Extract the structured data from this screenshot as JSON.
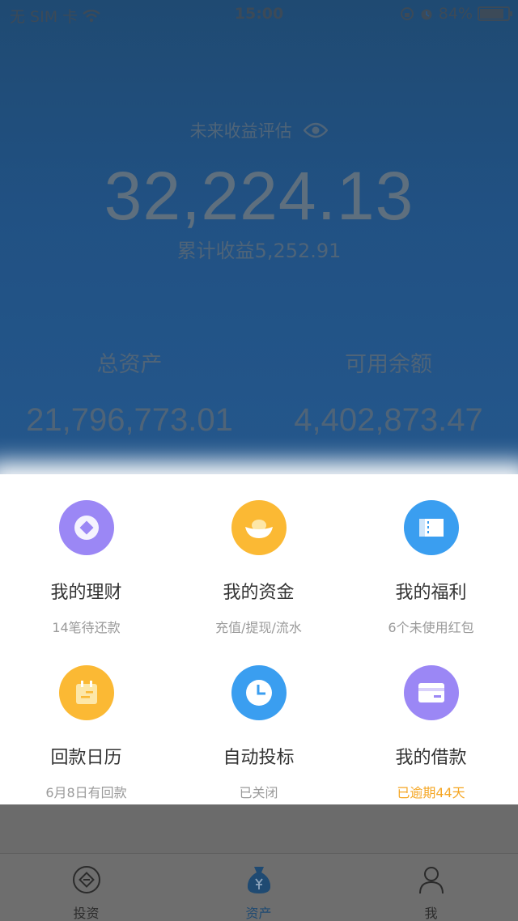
{
  "status_bar": {
    "carrier": "无 SIM 卡",
    "time": "15:00",
    "battery": "84%",
    "battery_level": 0.84
  },
  "summary": {
    "estimate_label": "未来收益评估",
    "estimate_value": "32,224.13",
    "cumulative": "累计收益5,252.91",
    "total_assets_label": "总资产",
    "total_assets_value": "21,796,773.01",
    "available_label": "可用余额",
    "available_value": "4,402,873.47"
  },
  "grid": [
    {
      "title": "我的理财",
      "sub": "14笔待还款",
      "icon": "diamond-coin-icon",
      "color": "#9b87f5"
    },
    {
      "title": "我的资金",
      "sub": "充值/提现/流水",
      "icon": "gold-ingot-icon",
      "color": "#fbb934"
    },
    {
      "title": "我的福利",
      "sub": "6个未使用红包",
      "icon": "ticket-icon",
      "color": "#3a9ef0"
    },
    {
      "title": "回款日历",
      "sub": "6月8日有回款",
      "icon": "calendar-icon",
      "color": "#fbb934"
    },
    {
      "title": "自动投标",
      "sub": "已关闭",
      "icon": "clock-icon",
      "color": "#3a9ef0"
    },
    {
      "title": "我的借款",
      "sub": "已逾期44天",
      "icon": "card-icon",
      "color": "#9b87f5",
      "sub_color": "#f5a623"
    }
  ],
  "tabs": [
    {
      "label": "投资",
      "icon": "invest-icon"
    },
    {
      "label": "资产",
      "icon": "money-bag-icon",
      "active": true
    },
    {
      "label": "我",
      "icon": "person-icon"
    }
  ]
}
